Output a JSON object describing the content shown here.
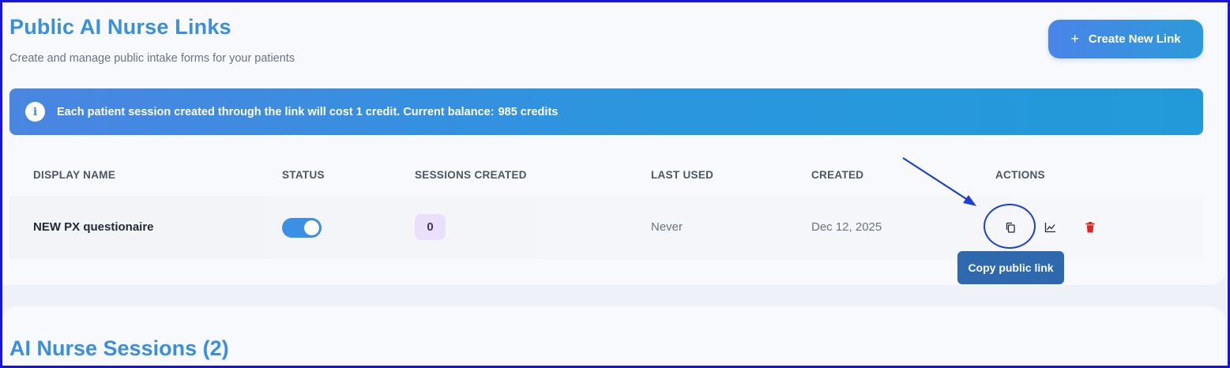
{
  "header": {
    "title": "Public AI Nurse Links",
    "subtitle": "Create and manage public intake forms for your patients",
    "create_button": {
      "icon": "plus-icon",
      "label": "Create New Link"
    }
  },
  "banner": {
    "icon": "info-icon",
    "text": "Each patient session created through the link will cost 1 credit. Current balance:",
    "balance": "985 credits"
  },
  "table": {
    "columns": [
      "DISPLAY NAME",
      "STATUS",
      "SESSIONS CREATED",
      "LAST USED",
      "CREATED",
      "ACTIONS"
    ],
    "rows": [
      {
        "display_name": "NEW PX questionaire",
        "status_enabled": true,
        "sessions_created": "0",
        "last_used": "Never",
        "created": "Dec 12, 2025",
        "actions": [
          "copy-icon",
          "chart-icon",
          "trash-icon"
        ]
      }
    ]
  },
  "tooltip": {
    "text": "Copy public link"
  },
  "sessions_section": {
    "title": "AI Nurse Sessions (2)"
  },
  "colors": {
    "accent": "#3a8fdc",
    "toggle_on": "#3b8fe5",
    "delete": "#dc2626",
    "annotation": "#1b3fd1"
  }
}
